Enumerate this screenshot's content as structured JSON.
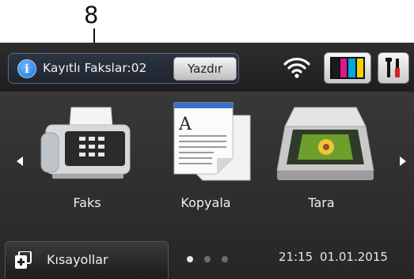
{
  "callout": {
    "number": "8"
  },
  "status": {
    "message": "Kayıtlı Fakslar:02",
    "print_label": "Yazdır",
    "ink_colors": [
      "#1b1b1b",
      "#d81b8c",
      "#00a5e3",
      "#f7d000"
    ]
  },
  "apps": [
    {
      "label": "Faks",
      "icon": "fax-icon"
    },
    {
      "label": "Kopyala",
      "icon": "copy-icon"
    },
    {
      "label": "Tara",
      "icon": "scanner-icon"
    }
  ],
  "bottom": {
    "shortcuts_label": "Kısayollar",
    "page_count": 3,
    "current_page": 1,
    "time": "21:15",
    "date": "01.01.2015"
  }
}
